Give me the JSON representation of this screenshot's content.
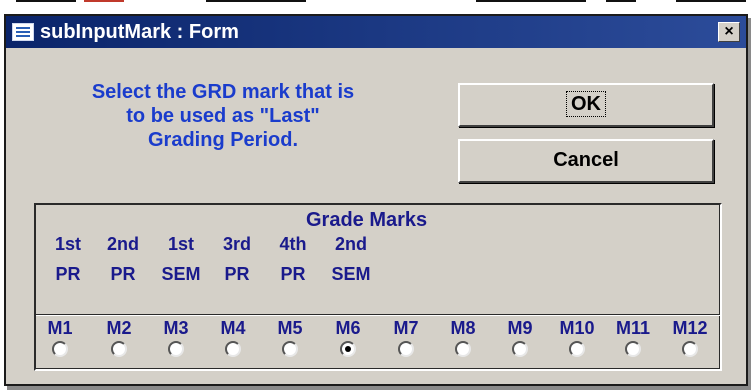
{
  "window": {
    "title": "subInputMark : Form",
    "close_label": "×"
  },
  "prompt": {
    "line1": "Select the GRD mark that is",
    "line2": "to be used as \"Last\"",
    "line3": "Grading Period."
  },
  "buttons": {
    "ok_label": "OK",
    "cancel_label": "Cancel"
  },
  "grade_marks": {
    "title": "Grade Marks",
    "column_labels": [
      {
        "line1": "1st",
        "line2": "PR"
      },
      {
        "line1": "2nd",
        "line2": "PR"
      },
      {
        "line1": "1st",
        "line2": "SEM"
      },
      {
        "line1": "3rd",
        "line2": "PR"
      },
      {
        "line1": "4th",
        "line2": "PR"
      },
      {
        "line1": "2nd",
        "line2": "SEM"
      }
    ],
    "marks": [
      "M1",
      "M2",
      "M3",
      "M4",
      "M5",
      "M6",
      "M7",
      "M8",
      "M9",
      "M10",
      "M11",
      "M12"
    ],
    "selected": "M6"
  }
}
